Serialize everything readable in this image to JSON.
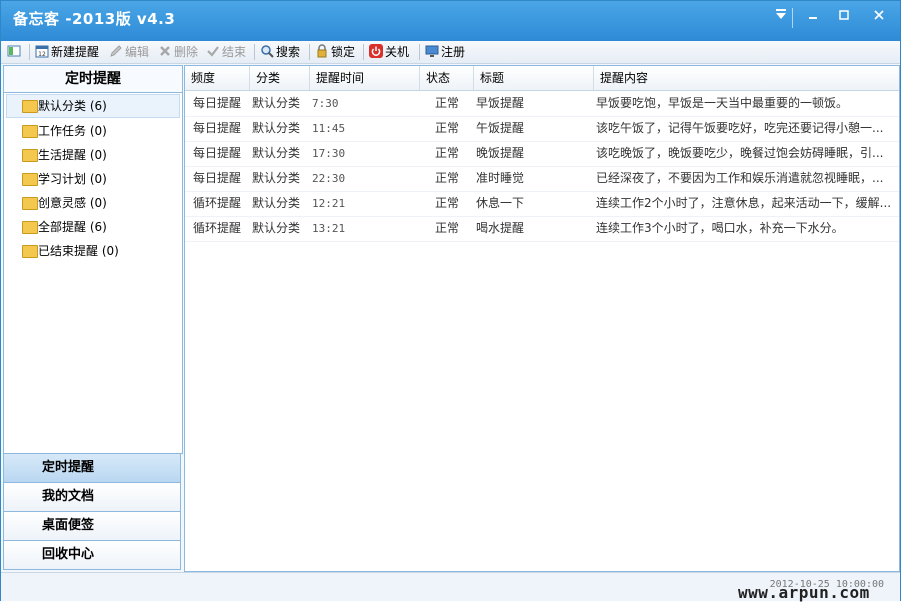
{
  "window": {
    "title": "备忘客 -2013版 v4.3"
  },
  "toolbar": {
    "new": "新建提醒",
    "edit": "编辑",
    "delete": "删除",
    "finish": "结束",
    "search": "搜索",
    "lock": "锁定",
    "shutdown": "关机",
    "register": "注册"
  },
  "left_panel": {
    "header": "定时提醒",
    "items": [
      {
        "label": "默认分类 (6)"
      },
      {
        "label": "工作任务 (0)"
      },
      {
        "label": "生活提醒 (0)"
      },
      {
        "label": "学习计划 (0)"
      },
      {
        "label": "创意灵感 (0)"
      },
      {
        "label": "全部提醒 (6)"
      },
      {
        "label": "已结束提醒 (0)"
      }
    ],
    "nav": [
      {
        "label": "定时提醒"
      },
      {
        "label": "我的文档"
      },
      {
        "label": "桌面便签"
      },
      {
        "label": "回收中心"
      }
    ]
  },
  "table": {
    "headers": [
      "频度",
      "分类",
      "提醒时间",
      "状态",
      "标题",
      "提醒内容"
    ],
    "rows": [
      [
        "每日提醒",
        "默认分类",
        "7:30",
        "正常",
        "早饭提醒",
        "早饭要吃饱，早饭是一天当中最重要的一顿饭。"
      ],
      [
        "每日提醒",
        "默认分类",
        "11:45",
        "正常",
        "午饭提醒",
        "该吃午饭了，记得午饭要吃好，吃完还要记得小憩一..."
      ],
      [
        "每日提醒",
        "默认分类",
        "17:30",
        "正常",
        "晚饭提醒",
        "该吃晚饭了，晚饭要吃少，晚餐过饱会妨碍睡眠，引..."
      ],
      [
        "每日提醒",
        "默认分类",
        "22:30",
        "正常",
        "准时睡觉",
        "已经深夜了，不要因为工作和娱乐消遣就忽视睡眠，..."
      ],
      [
        "循环提醒",
        "默认分类",
        "12:21",
        "正常",
        "休息一下",
        "连续工作2个小时了，注意休息，起来活动一下，缓解..."
      ],
      [
        "循环提醒",
        "默认分类",
        "13:21",
        "正常",
        "喝水提醒",
        "连续工作3个小时了，喝口水，补充一下水分。"
      ]
    ]
  },
  "status": {
    "timestamp": "2012-10-25 10:00:00"
  },
  "watermark": "www.arpun.com"
}
